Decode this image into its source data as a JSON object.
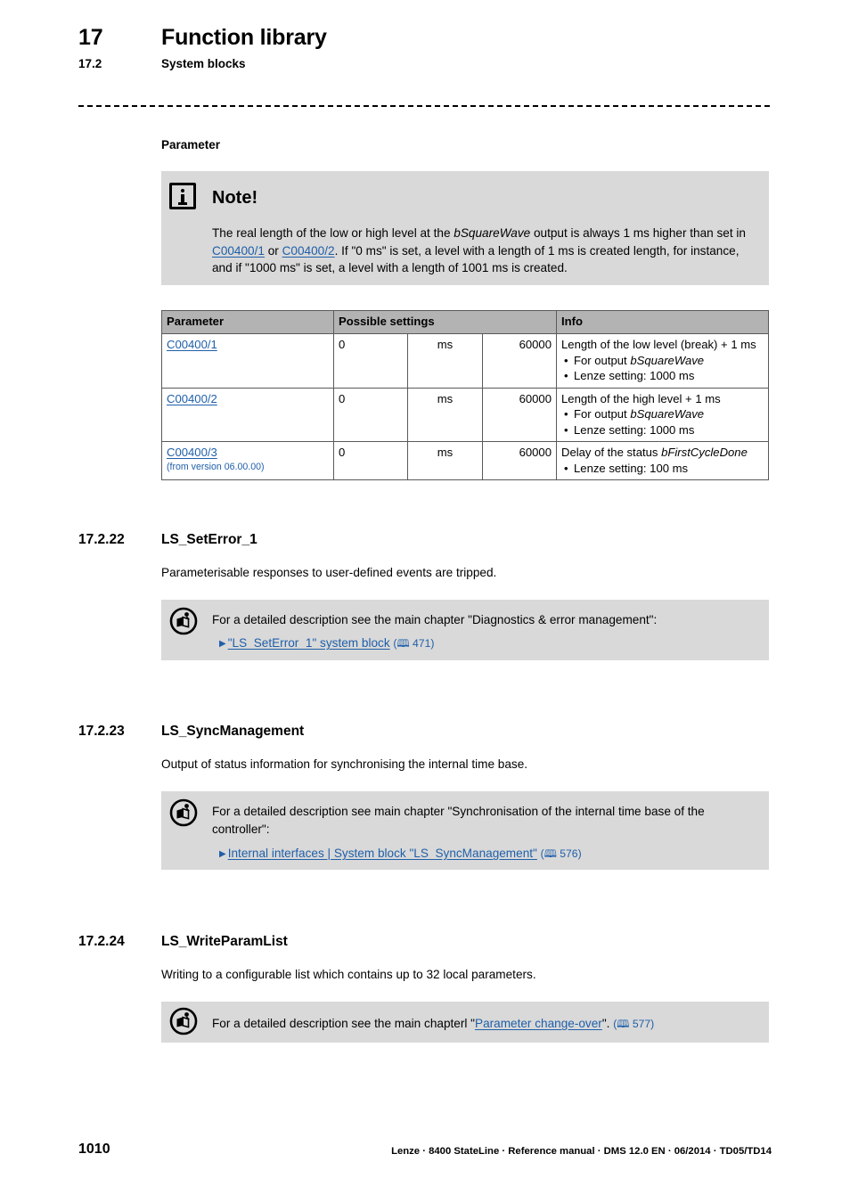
{
  "header": {
    "chapter_number": "17",
    "chapter_title": "Function library",
    "section_number": "17.2",
    "section_title": "System blocks"
  },
  "parameter_label": "Parameter",
  "note": {
    "icon": "info-icon",
    "title": "Note!",
    "text_part1": "The real length of the low or high level at the ",
    "text_italic1": "bSquareWave",
    "text_part2": " output is always 1 ms higher than set in ",
    "link1": "C00400/1",
    "text_part3": " or ",
    "link2": "C00400/2",
    "text_part4": ". If \"0 ms\" is set, a level with a length of 1 ms is created length, for instance, and if \"1000 ms\" is set, a level with a length of 1001 ms is created."
  },
  "table": {
    "headers": {
      "parameter": "Parameter",
      "possible_settings": "Possible settings",
      "info": "Info"
    },
    "rows": [
      {
        "parameter": "C00400/1",
        "version": "",
        "min": "0",
        "unit": "ms",
        "max": "60000",
        "info_title": "Length of the low level (break) + 1 ms",
        "info_bullets": [
          {
            "pre": "For output ",
            "italic": "bSquareWave",
            "post": ""
          },
          {
            "pre": "Lenze setting: 1000 ms",
            "italic": "",
            "post": ""
          }
        ]
      },
      {
        "parameter": "C00400/2",
        "version": "",
        "min": "0",
        "unit": "ms",
        "max": "60000",
        "info_title": "Length of the high level + 1 ms",
        "info_bullets": [
          {
            "pre": "For output ",
            "italic": "bSquareWave",
            "post": ""
          },
          {
            "pre": "Lenze setting: 1000 ms",
            "italic": "",
            "post": ""
          }
        ]
      },
      {
        "parameter": "C00400/3",
        "version": "(from version 06.00.00)",
        "min": "0",
        "unit": "ms",
        "max": "60000",
        "info_title_pre": "Delay of the status ",
        "info_title_italic": "bFirstCycleDone",
        "info_bullets": [
          {
            "pre": "Lenze setting: 100 ms",
            "italic": "",
            "post": ""
          }
        ]
      }
    ]
  },
  "sections": [
    {
      "number": "17.2.22",
      "title": "LS_SetError_1",
      "description": "Parameterisable responses to user-defined events are tripped.",
      "hint": {
        "icon": "read-documentation-icon",
        "text": "For a detailed description see the main chapter \"Diagnostics & error management\":",
        "link_text": "\"LS_SetError_1\" system block",
        "page_ref": "471",
        "book_glyph": "🕮"
      }
    },
    {
      "number": "17.2.23",
      "title": "LS_SyncManagement",
      "description": "Output of status information for synchronising the internal time base.",
      "hint": {
        "icon": "read-documentation-icon",
        "text": "For a detailed description see main chapter \"Synchronisation of the internal time base of the controller\":",
        "link_text": "Internal interfaces | System block \"LS_SyncManagement\"",
        "page_ref": "576",
        "book_glyph": "🕮"
      }
    },
    {
      "number": "17.2.24",
      "title": "LS_WriteParamList",
      "description": "Writing to a configurable list which contains up to 32 local parameters.",
      "hint": {
        "icon": "read-documentation-icon",
        "text_pre": "For a detailed description see the main chapterl \"",
        "link_text": "Parameter change-over",
        "text_post": "\". ",
        "page_ref": "577",
        "book_glyph": "🕮"
      }
    }
  ],
  "footer": {
    "page_number": "1010",
    "meta": "Lenze · 8400 StateLine · Reference manual · DMS 12.0 EN · 06/2014 · TD05/TD14"
  },
  "colors": {
    "link": "#1f5fa9",
    "box_bg": "#d9d9d9",
    "table_header_bg": "#b3b3b3",
    "table_border": "#5a5a5a"
  }
}
